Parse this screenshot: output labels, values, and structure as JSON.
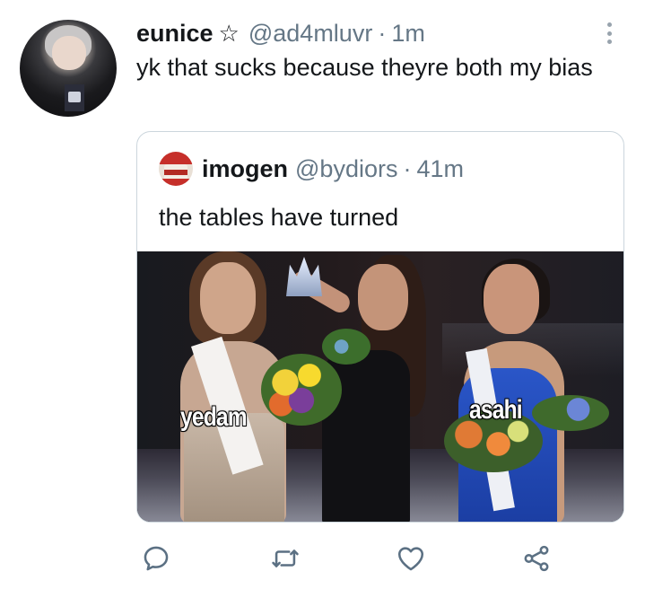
{
  "tweet": {
    "display_name": "eunice",
    "badge_icon": "star-icon",
    "badge_glyph": "☆",
    "handle": "@ad4mluvr",
    "separator": "·",
    "time": "1m",
    "text": "yk that sucks because theyre both my bias"
  },
  "menu": {
    "icon": "more-vertical-icon"
  },
  "quoted_tweet": {
    "display_name": "imogen",
    "handle": "@bydiors",
    "separator": "·",
    "time": "41m",
    "text": "the tables have turned",
    "media": {
      "labels": {
        "left": "yedam",
        "right": "asahi"
      }
    }
  },
  "actions": [
    {
      "name": "reply",
      "icon": "reply-icon"
    },
    {
      "name": "retweet",
      "icon": "retweet-icon"
    },
    {
      "name": "like",
      "icon": "heart-icon"
    },
    {
      "name": "share",
      "icon": "share-icon"
    }
  ],
  "colors": {
    "text": "#14171a",
    "secondary": "#657786",
    "border": "#ccd6dd",
    "icon": "#5b7083"
  }
}
